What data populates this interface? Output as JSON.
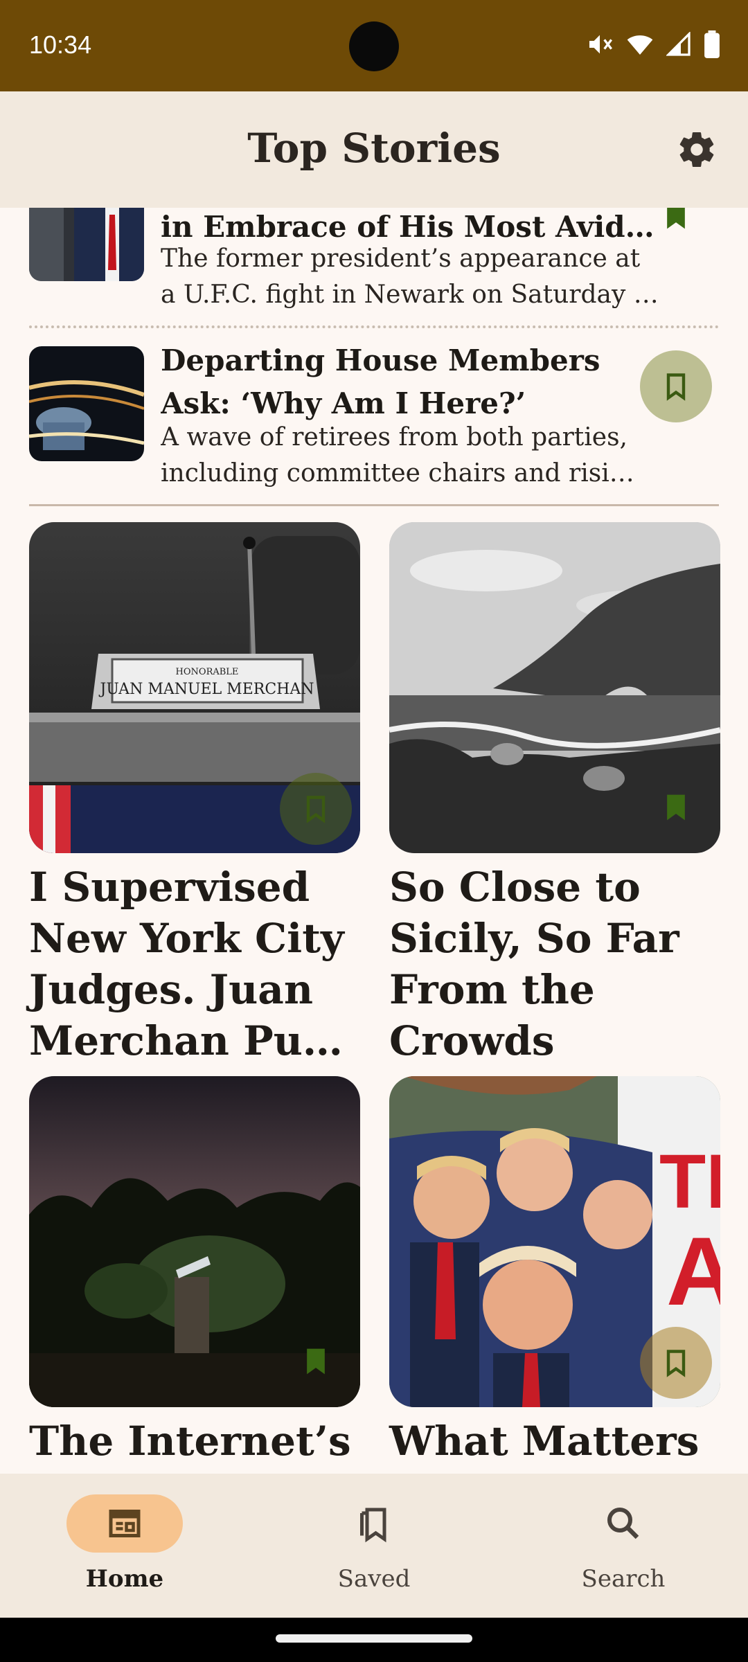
{
  "status_bar": {
    "time": "10:34"
  },
  "app_bar": {
    "title": "Top Stories",
    "settings_icon": "gear-icon"
  },
  "list_items": [
    {
      "title": "in Embrace of His Most Avid…",
      "summary_line1": "The former president’s appearance at",
      "summary_line2": "a U.F.C. fight in Newark on Saturday …",
      "saved": true
    },
    {
      "title_line1": "Departing House Members",
      "title_line2": "Ask: ‘Why Am I Here?’",
      "summary_line1": "A wave of retirees from both parties,",
      "summary_line2": "including committee chairs and risi…",
      "saved": false
    }
  ],
  "cards": [
    {
      "title": "I Supervised New York City Judges. Juan Merchan Pu…",
      "image_caption_small": "HONORABLE",
      "image_caption": "JUAN MANUEL MERCHAN"
    },
    {
      "title": "So Close to Sicily, So Far From the Crowds"
    },
    {
      "title": "The Internet’s"
    },
    {
      "title": "What Matters"
    }
  ],
  "nav": {
    "items": [
      {
        "label": "Home",
        "icon": "newspaper-icon",
        "active": true
      },
      {
        "label": "Saved",
        "icon": "bookmarks-icon",
        "active": false
      },
      {
        "label": "Search",
        "icon": "search-icon",
        "active": false
      }
    ]
  },
  "colors": {
    "status_bar": "#6e4a06",
    "app_bar": "#f2e9de",
    "background": "#fdf7f3",
    "accent_pill": "#f7c48f",
    "bookmark_green": "#3b6a13"
  }
}
